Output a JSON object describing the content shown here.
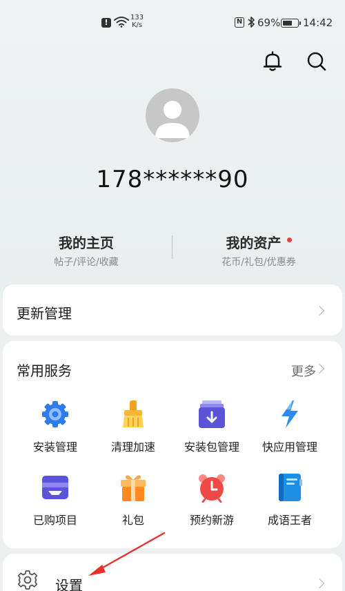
{
  "status_bar": {
    "net_speed_value": "133",
    "net_speed_unit": "K/s",
    "nfc": "N",
    "battery": "69%",
    "battery_level": 0.69,
    "time": "14:42"
  },
  "header": {
    "bell_icon": "bell-icon",
    "search_icon": "search-icon"
  },
  "profile": {
    "phone": "178******90",
    "home_title": "我的主页",
    "home_sub": "帖子/评论/收藏",
    "assets_title": "我的资产",
    "assets_sub": "花币/礼包/优惠券"
  },
  "update_row": {
    "label": "更新管理"
  },
  "services": {
    "title": "常用服务",
    "more": "更多",
    "items": [
      {
        "label": "安装管理",
        "icon": "gear-icon"
      },
      {
        "label": "清理加速",
        "icon": "broom-icon"
      },
      {
        "label": "安装包管理",
        "icon": "package-icon"
      },
      {
        "label": "快应用管理",
        "icon": "lightning-icon"
      },
      {
        "label": "已购项目",
        "icon": "purchased-icon"
      },
      {
        "label": "礼包",
        "icon": "gift-icon"
      },
      {
        "label": "预约新游",
        "icon": "alarm-clock-icon"
      },
      {
        "label": "成语王者",
        "icon": "book-icon"
      }
    ]
  },
  "settings_row": {
    "label": "设置",
    "icon": "settings-gear-icon"
  },
  "colors": {
    "background": "#ecf0f1",
    "card": "#ffffff",
    "accent_blue": "#3b8cf5",
    "red_dot": "#e8403a",
    "annotation_arrow": "#e8302a"
  }
}
